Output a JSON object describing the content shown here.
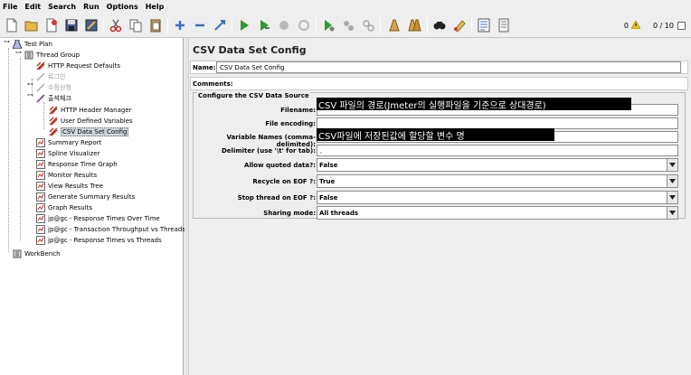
{
  "menu": [
    "File",
    "Edit",
    "Search",
    "Run",
    "Options",
    "Help"
  ],
  "status": {
    "warnings": "0",
    "threads": "0 / 10"
  },
  "toolbar": [
    "new-icon",
    "open-icon",
    "open-template-icon",
    "save-icon",
    "save-screen-icon",
    "cut-icon",
    "copy-icon",
    "paste-icon",
    "expand-icon",
    "collapse-icon",
    "toggle-icon",
    "start-icon",
    "start-no-pauses-icon",
    "stop-icon",
    "shutdown-icon",
    "remote-start-icon",
    "remote-stop-icon",
    "remote-shutdown-icon",
    "clear-icon",
    "clear-all-icon",
    "search-icon",
    "reset-search-icon",
    "function-helper-icon",
    "help-icon"
  ],
  "tree": {
    "test_plan": "Test Plan",
    "thread_group": "Thread Group",
    "http_defaults": "HTTP Request Defaults",
    "login": "로그인",
    "modify": "수정신청",
    "list": "출석체크",
    "header_manager": "HTTP Header Manager",
    "user_vars": "User Defined Variables",
    "csv_config": "CSV Data Set Config",
    "summary_report": "Summary Report",
    "spline": "Spline Visualizer",
    "resp_graph": "Response Time Graph",
    "monitor": "Monitor Results",
    "view_tree": "View Results Tree",
    "gen_summary": "Generate Summary Results",
    "graph_results": "Graph Results",
    "rt_over_time": "jp@gc - Response Times Over Time",
    "tx_vs_threads": "jp@gc - Transaction Throughput vs Threads",
    "rt_vs_threads": "jp@gc - Response Times vs Threads",
    "workbench": "WorkBench"
  },
  "panel": {
    "title": "CSV Data Set Config",
    "name_label": "Name:",
    "name_value": "CSV Data Set Config",
    "comments_label": "Comments:",
    "group_title": "Configure the CSV Data Source",
    "filename_label": "Filename:",
    "filename_annotation": "CSV 파일의 경로(Jmeter의 실행파일을 기준으로 상대경로)",
    "encoding_label": "File encoding:",
    "varnames_label": "Variable Names (comma-delimited):",
    "varnames_annotation": "CSV파일에 저장된값에 할당할 변수 명",
    "delimiter_label": "Delimiter (use '\\t' for tab):",
    "delimiter_value": ",",
    "quoted_label": "Allow quoted data?:",
    "quoted_value": "False",
    "recycle_label": "Recycle on EOF ?:",
    "recycle_value": "True",
    "stop_label": "Stop thread on EOF ?:",
    "stop_value": "False",
    "sharing_label": "Sharing mode:",
    "sharing_value": "All threads"
  }
}
